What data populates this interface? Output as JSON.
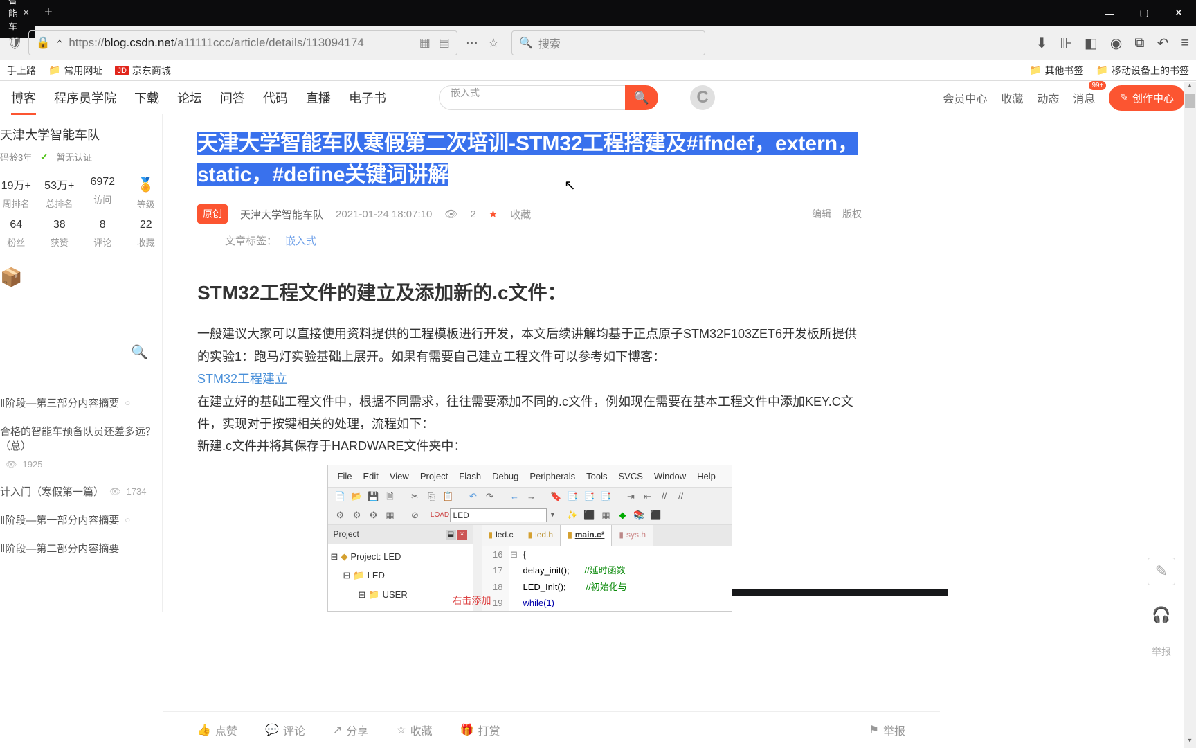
{
  "browser": {
    "tab_title": "智能车",
    "new_tab": "+",
    "url": "https://blog.csdn.net/a11111ccc/article/details/113094174",
    "url_display_prefix": "https://",
    "url_display_host": "blog.csdn.net",
    "url_display_path": "/a11111ccc/article/details/113094174",
    "search_placeholder": "搜索"
  },
  "bookmarks": {
    "items": [
      "手上路",
      "常用网址",
      "京东商城"
    ],
    "right": [
      "其他书签",
      "移动设备上的书签"
    ]
  },
  "csdn_nav": {
    "items": [
      "博客",
      "程序员学院",
      "下载",
      "论坛",
      "问答",
      "代码",
      "直播",
      "电子书"
    ],
    "search_placeholder": "嵌入式",
    "right": [
      "会员中心",
      "收藏",
      "动态",
      "消息"
    ],
    "badge": "99+",
    "create": "创作中心"
  },
  "sidebar": {
    "profile_name": "天津大学智能车队",
    "age_label": "码龄3年",
    "verify": "暂无认证",
    "stats_row1": [
      {
        "num": "19万+",
        "label": "周排名"
      },
      {
        "num": "53万+",
        "label": "总排名"
      },
      {
        "num": "6972",
        "label": "访问"
      },
      {
        "num": "",
        "label": "等级"
      }
    ],
    "stats_row2": [
      {
        "num": "64",
        "label": "粉丝"
      },
      {
        "num": "38",
        "label": "获赞"
      },
      {
        "num": "8",
        "label": "评论"
      },
      {
        "num": "22",
        "label": "收藏"
      }
    ],
    "articles": [
      {
        "title": "Ⅱ阶段—第三部分内容摘要",
        "views": ""
      },
      {
        "title": "合格的智能车预备队员还差多远？（总）",
        "views": "1925"
      },
      {
        "title": "计入门（寒假第一篇）",
        "views": "1734"
      },
      {
        "title": "Ⅱ阶段—第一部分内容摘要",
        "views": ""
      },
      {
        "title": "Ⅱ阶段—第二部分内容摘要",
        "views": ""
      }
    ]
  },
  "article": {
    "title": "天津大学智能车队寒假第二次培训-STM32工程搭建及#ifndef，extern，static，#define关键词讲解",
    "orig_badge": "原创",
    "author": "天津大学智能车队",
    "date": "2021-01-24 18:07:10",
    "views": "2",
    "favorite": "收藏",
    "edit": "编辑",
    "copyright": "版权",
    "tag_label": "文章标签：",
    "tags": [
      "嵌入式"
    ],
    "h2": "STM32工程文件的建立及添加新的.c文件：",
    "p1": "一般建议大家可以直接使用资料提供的工程模板进行开发，本文后续讲解均基于正点原子STM32F103ZET6开发板所提供的实验1：跑马灯实验基础上展开。如果有需要自己建立工程文件可以参考如下博客：",
    "link1": "STM32工程建立",
    "p2": "在建立好的基础工程文件中，根据不同需求，往往需要添加不同的.c文件，例如现在需要在基本工程文件中添加KEY.C文件，实现对于按键相关的处理，流程如下：",
    "p3": "新建.c文件并将其保存于HARDWARE文件夹中："
  },
  "ide": {
    "menu": [
      "File",
      "Edit",
      "View",
      "Project",
      "Flash",
      "Debug",
      "Peripherals",
      "Tools",
      "SVCS",
      "Window",
      "Help"
    ],
    "target": "LED",
    "project_panel": "Project",
    "tree": {
      "root": "Project: LED",
      "l1": "LED",
      "l2": "USER"
    },
    "anno": "右击添加",
    "tabs": [
      "led.c",
      "led.h",
      "main.c*",
      "sys.h"
    ],
    "code": [
      {
        "n": "16",
        "fold": "⊟",
        "text": "{"
      },
      {
        "n": "17",
        "fold": "",
        "text": "    delay_init();",
        "comment": "//延时函数"
      },
      {
        "n": "18",
        "fold": "",
        "text": "    LED_Init();",
        "comment": "//初始化与"
      },
      {
        "n": "19",
        "fold": "",
        "text": "    while(1)",
        "kw": true
      }
    ]
  },
  "actions": {
    "like": "点赞",
    "comment": "评论",
    "share": "分享",
    "favorite": "收藏",
    "reward": "打赏",
    "report": "举报"
  },
  "float_report": "举报"
}
